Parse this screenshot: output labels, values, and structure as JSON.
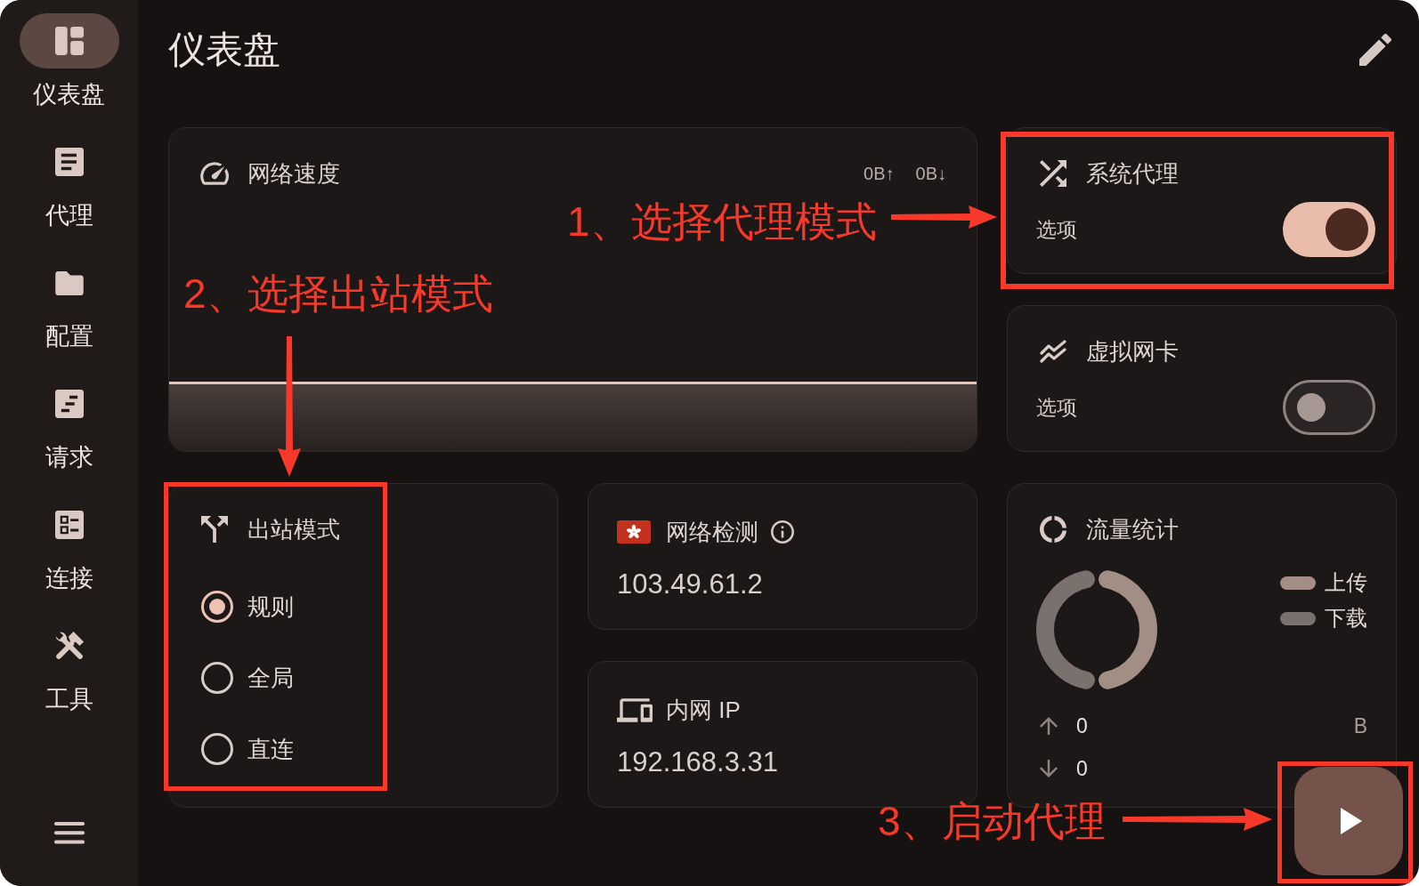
{
  "sidebar": {
    "items": [
      {
        "label": "仪表盘",
        "selected": true
      },
      {
        "label": "代理",
        "selected": false
      },
      {
        "label": "配置",
        "selected": false
      },
      {
        "label": "请求",
        "selected": false
      },
      {
        "label": "连接",
        "selected": false
      },
      {
        "label": "工具",
        "selected": false
      }
    ]
  },
  "header": {
    "title": "仪表盘"
  },
  "network_speed": {
    "title": "网络速度",
    "upload": "0B↑",
    "download": "0B↓"
  },
  "toggle_cards": [
    {
      "title": "系统代理",
      "option_label": "选项",
      "on": true
    },
    {
      "title": "虚拟网卡",
      "option_label": "选项",
      "on": false
    }
  ],
  "outbound_mode": {
    "title": "出站模式",
    "options": [
      {
        "label": "规则",
        "selected": true
      },
      {
        "label": "全局",
        "selected": false
      },
      {
        "label": "直连",
        "selected": false
      }
    ]
  },
  "network_check": {
    "title": "网络检测",
    "ip": "103.49.61.2"
  },
  "lan_ip": {
    "title": "内网 IP",
    "ip": "192.168.3.31"
  },
  "traffic": {
    "title": "流量统计",
    "legend": [
      {
        "label": "上传",
        "color": "#a38e86"
      },
      {
        "label": "下载",
        "color": "#7a706d"
      }
    ],
    "stats": [
      {
        "kind": "upload",
        "value": "0",
        "unit": "B"
      },
      {
        "kind": "download",
        "value": "0"
      }
    ]
  },
  "annotations": [
    {
      "text": "1、选择代理模式"
    },
    {
      "text": "2、选择出站模式"
    },
    {
      "text": "3、启动代理"
    }
  ]
}
